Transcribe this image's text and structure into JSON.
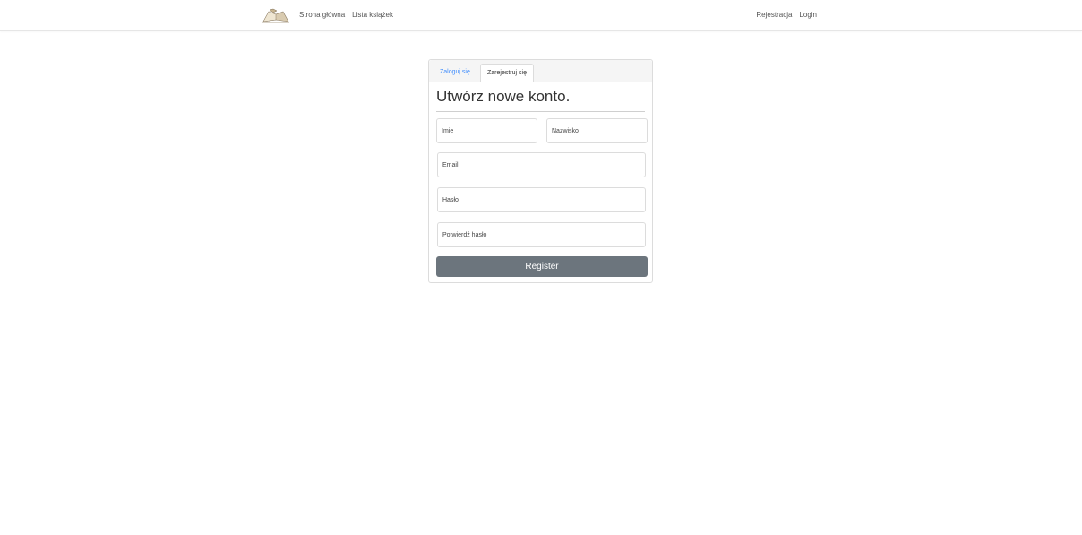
{
  "navbar": {
    "logo_icon": "open-book-icon",
    "left_links": [
      "Strona główna",
      "Lista książek"
    ],
    "right_links": [
      "Rejestracja",
      "Login"
    ]
  },
  "card": {
    "tabs": [
      {
        "label": "Zaloguj się",
        "active": false
      },
      {
        "label": "Zarejestruj się",
        "active": true
      }
    ],
    "title": "Utwórz nowe konto.",
    "fields": {
      "first_name": {
        "placeholder": "Imie",
        "value": ""
      },
      "last_name": {
        "placeholder": "Nazwisko",
        "value": ""
      },
      "email": {
        "placeholder": "Email",
        "value": ""
      },
      "password": {
        "placeholder": "Hasło",
        "value": ""
      },
      "confirm_password": {
        "placeholder": "Potwierdź hasło",
        "value": ""
      }
    },
    "submit_label": "Register"
  },
  "colors": {
    "accent_link": "#3d8bfd",
    "button_bg": "#6c757d",
    "border": "#dcdcdc"
  }
}
